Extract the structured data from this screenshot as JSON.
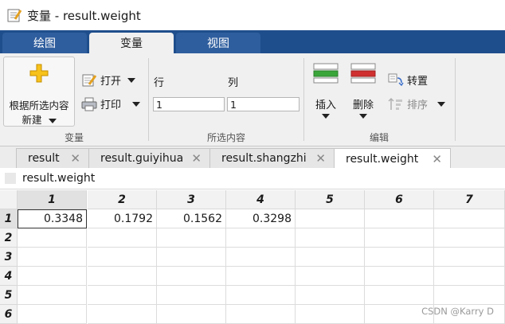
{
  "window": {
    "title": "变量 - result.weight"
  },
  "ribbon_tabs": [
    {
      "label": "绘图",
      "active": false
    },
    {
      "label": "变量",
      "active": true
    },
    {
      "label": "视图",
      "active": false
    }
  ],
  "ribbon": {
    "groups": {
      "variable": {
        "label": "变量",
        "new_from_selection_line1": "根据所选内容",
        "new_from_selection_line2": "新建",
        "open_label": "打开",
        "print_label": "打印"
      },
      "selection": {
        "label": "所选内容",
        "row_label": "行",
        "col_label": "列",
        "row_value": "1",
        "col_value": "1"
      },
      "edit": {
        "label": "编辑",
        "insert_label": "插入",
        "delete_label": "删除",
        "transpose_label": "转置",
        "sort_label": "排序"
      }
    }
  },
  "doc_tabs": [
    {
      "label": "result",
      "active": false
    },
    {
      "label": "result.guiyihua",
      "active": false
    },
    {
      "label": "result.shangzhi",
      "active": false
    },
    {
      "label": "result.weight",
      "active": true
    }
  ],
  "variable_name": "result.weight",
  "grid": {
    "column_headers": [
      "1",
      "2",
      "3",
      "4",
      "5",
      "6",
      "7"
    ],
    "row_headers": [
      "1",
      "2",
      "3",
      "4",
      "5",
      "6"
    ],
    "rows": [
      [
        "0.3348",
        "0.1792",
        "0.1562",
        "0.3298",
        "",
        "",
        ""
      ],
      [
        "",
        "",
        "",
        "",
        "",
        "",
        ""
      ],
      [
        "",
        "",
        "",
        "",
        "",
        "",
        ""
      ],
      [
        "",
        "",
        "",
        "",
        "",
        "",
        ""
      ],
      [
        "",
        "",
        "",
        "",
        "",
        "",
        ""
      ],
      [
        "",
        "",
        "",
        "",
        "",
        "",
        ""
      ]
    ]
  },
  "watermark": "CSDN @Karry D",
  "colors": {
    "ribbon_tab_bar": "#1f4e8c",
    "insert_icon": "#3aa63a",
    "delete_icon": "#d03030"
  }
}
